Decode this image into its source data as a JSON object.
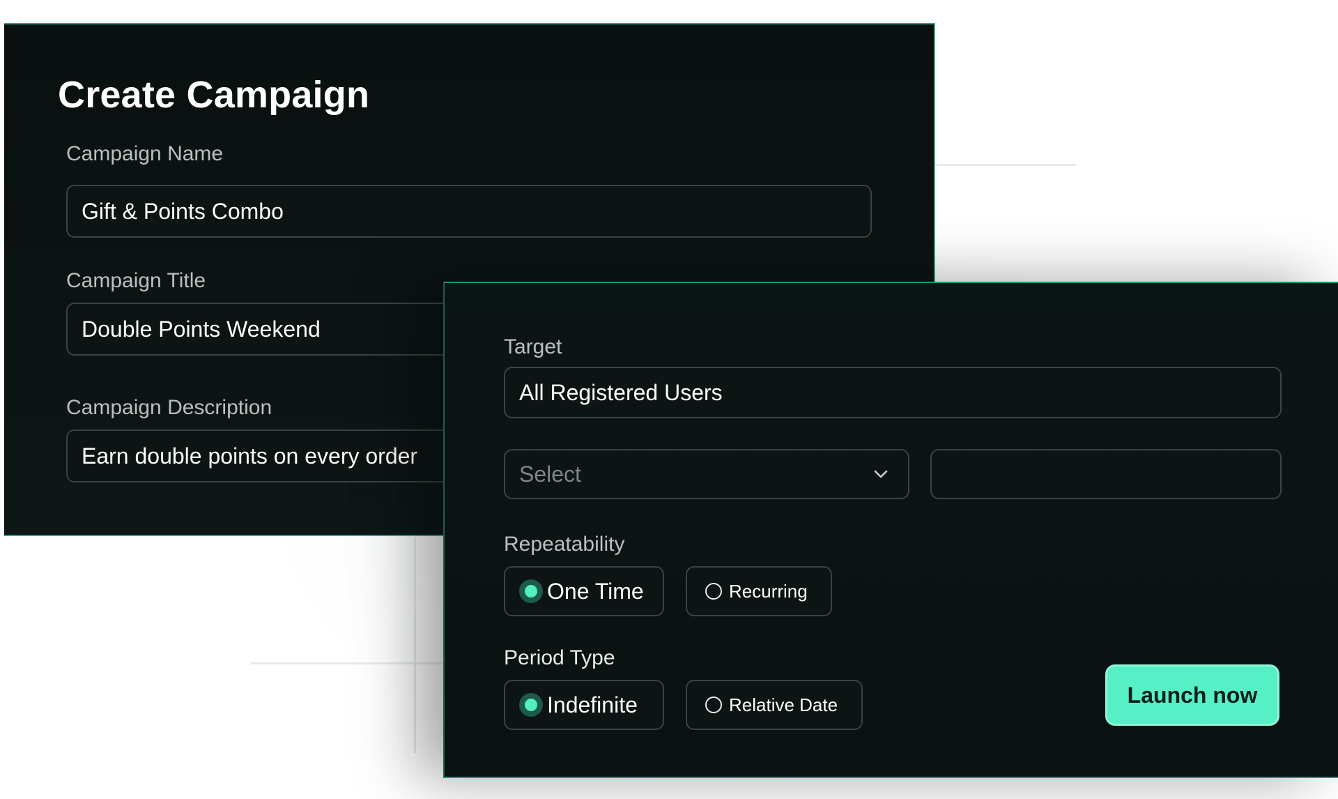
{
  "form": {
    "title": "Create Campaign",
    "campaign_name": {
      "label": "Campaign Name",
      "value": "Gift & Points Combo"
    },
    "campaign_title": {
      "label": "Campaign Title",
      "value": "Double Points Weekend"
    },
    "campaign_description": {
      "label": "Campaign Description",
      "value": "Earn double points on every order"
    }
  },
  "settings": {
    "target": {
      "label": "Target",
      "value": "All Registered Users"
    },
    "select": {
      "placeholder": "Select",
      "icon": "chevron-down-icon"
    },
    "extra_input": {
      "value": ""
    },
    "repeatability": {
      "label": "Repeatability",
      "options": [
        {
          "label": "One Time",
          "selected": true
        },
        {
          "label": "Recurring",
          "selected": false
        }
      ]
    },
    "period_type": {
      "label": "Period Type",
      "options": [
        {
          "label": "Indefinite",
          "selected": true
        },
        {
          "label": "Relative Date",
          "selected": false
        }
      ]
    },
    "launch_label": "Launch now"
  },
  "colors": {
    "panel_bg": "#0b1212",
    "accent": "#57f0c6",
    "accent_border": "#29a88a",
    "field_border": "#3b4443"
  }
}
